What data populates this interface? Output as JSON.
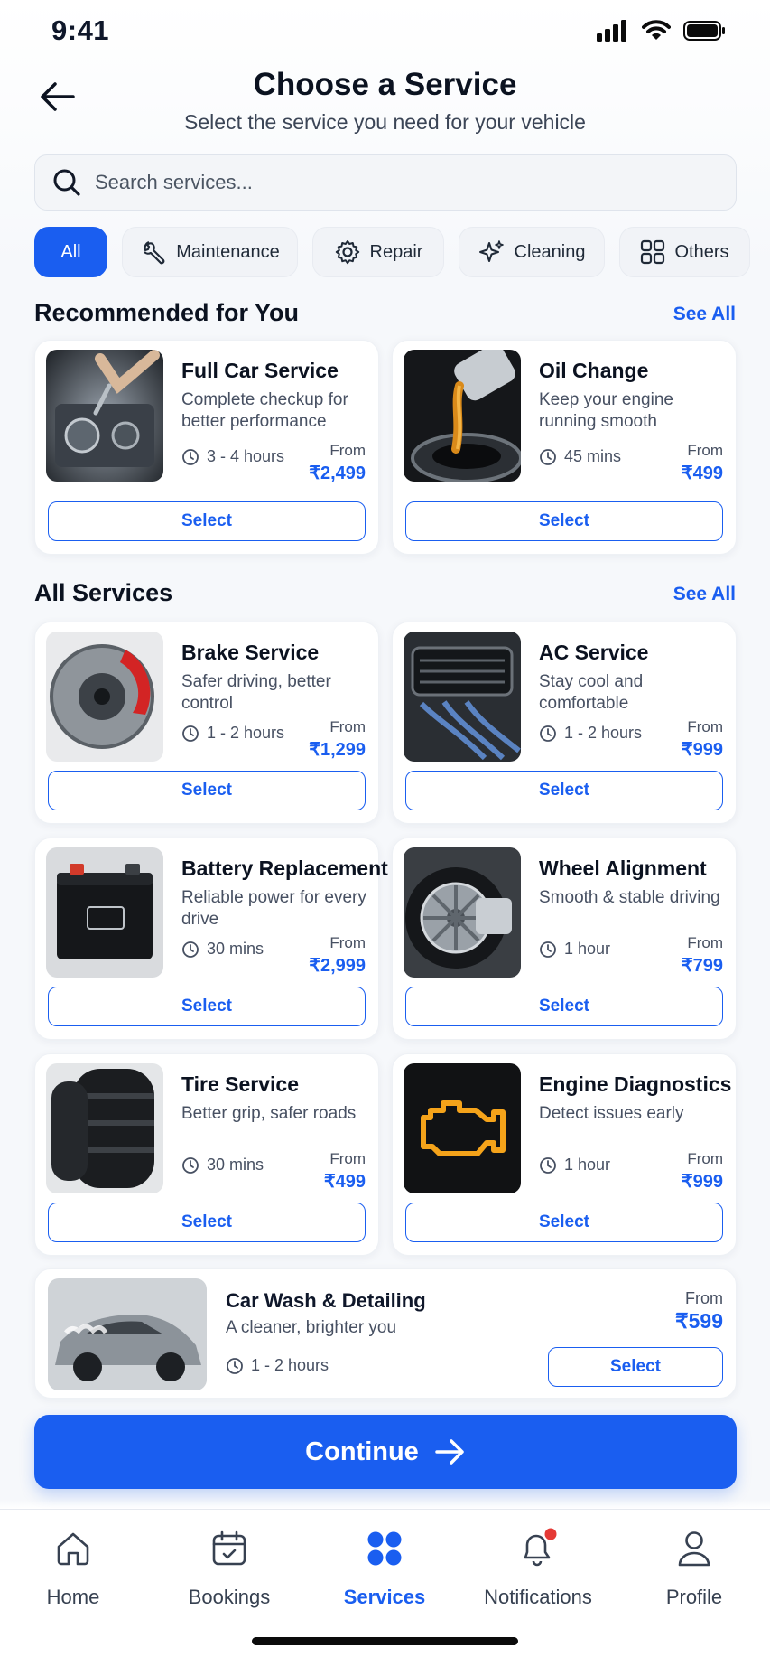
{
  "status_bar": {
    "time": "9:41"
  },
  "header": {
    "title": "Choose a Service",
    "subtitle": "Select the service you need for your vehicle"
  },
  "search": {
    "placeholder": "Search services...",
    "value": ""
  },
  "categories": [
    {
      "label": "All",
      "icon": "none",
      "active": true
    },
    {
      "label": "Maintenance",
      "icon": "wrench-icon",
      "active": false
    },
    {
      "label": "Repair",
      "icon": "gear-icon",
      "active": false
    },
    {
      "label": "Cleaning",
      "icon": "sparkle-icon",
      "active": false
    },
    {
      "label": "Others",
      "icon": "grid-icon",
      "active": false
    }
  ],
  "recommended": {
    "title": "Recommended for You",
    "see_all": "See All",
    "items": [
      {
        "name": "Full Car Service",
        "desc": "Complete checkup for better performance",
        "duration": "3 - 4 hours",
        "from": "From",
        "price": "₹2,499",
        "select": "Select",
        "image": "engine-image"
      },
      {
        "name": "Oil Change",
        "desc": "Keep your engine running smooth",
        "duration": "45 mins",
        "from": "From",
        "price": "₹499",
        "select": "Select",
        "image": "oil-pour-image"
      }
    ]
  },
  "all_services": {
    "title": "All Services",
    "see_all": "See All",
    "items": [
      {
        "name": "Brake Service",
        "desc": "Safer driving, better control",
        "duration": "1 - 2 hours",
        "from": "From",
        "price": "₹1,299",
        "select": "Select",
        "image": "brake-disc-image"
      },
      {
        "name": "AC Service",
        "desc": "Stay cool and comfortable",
        "duration": "1 - 2 hours",
        "from": "From",
        "price": "₹999",
        "select": "Select",
        "image": "ac-vent-image"
      },
      {
        "name": "Battery Replacement",
        "desc": "Reliable power for every drive",
        "duration": "30 mins",
        "from": "From",
        "price": "₹2,999",
        "select": "Select",
        "image": "battery-image"
      },
      {
        "name": "Wheel Alignment",
        "desc": "Smooth & stable driving",
        "duration": "1 hour",
        "from": "From",
        "price": "₹799",
        "select": "Select",
        "image": "wheel-image"
      },
      {
        "name": "Tire Service",
        "desc": "Better grip, safer roads",
        "duration": "30 mins",
        "from": "From",
        "price": "₹499",
        "select": "Select",
        "image": "tires-image"
      },
      {
        "name": "Engine Diagnostics",
        "desc": "Detect issues early",
        "duration": "1 hour",
        "from": "From",
        "price": "₹999",
        "select": "Select",
        "image": "check-engine-image"
      }
    ],
    "wide_item": {
      "name": "Car Wash & Detailing",
      "desc": "A cleaner, brighter you",
      "duration": "1 - 2 hours",
      "from": "From",
      "price": "₹599",
      "select": "Select",
      "image": "car-wash-image"
    }
  },
  "continue_label": "Continue",
  "bottom_nav": [
    {
      "label": "Home",
      "icon": "home-icon",
      "active": false
    },
    {
      "label": "Bookings",
      "icon": "calendar-icon",
      "active": false
    },
    {
      "label": "Services",
      "icon": "services-icon",
      "active": true
    },
    {
      "label": "Notifications",
      "icon": "bell-icon",
      "active": false,
      "badge": true
    },
    {
      "label": "Profile",
      "icon": "user-icon",
      "active": false
    }
  ],
  "colors": {
    "accent": "#1a5ef0",
    "badge": "#e53935",
    "text": "#0b1220",
    "muted": "#475062"
  }
}
